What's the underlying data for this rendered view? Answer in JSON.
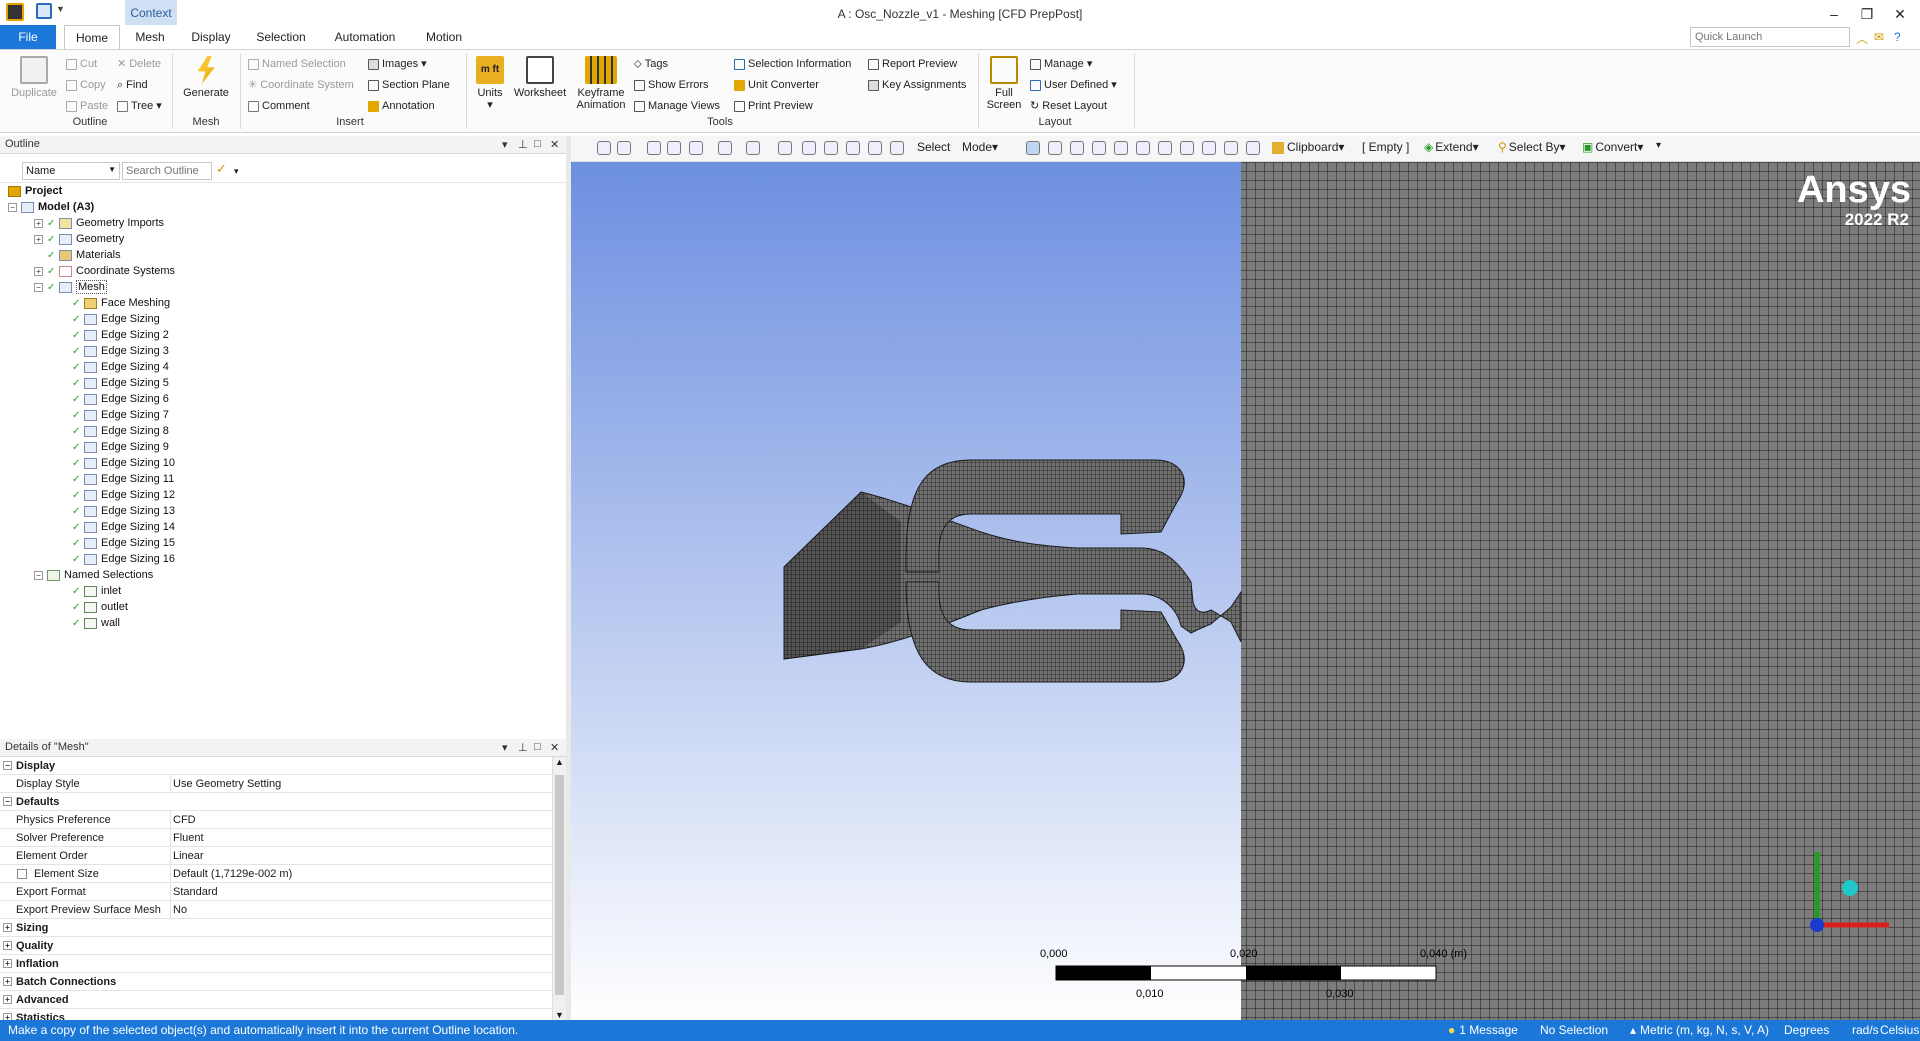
{
  "window": {
    "title": "A : Osc_Nozzle_v1 - Meshing [CFD PrepPost]",
    "context_tab": "Context"
  },
  "tabs": [
    "File",
    "Home",
    "Mesh",
    "Display",
    "Selection",
    "Automation",
    "Motion"
  ],
  "quick_launch": {
    "placeholder": "Quick Launch"
  },
  "ribbon": {
    "outline": {
      "duplicate": "Duplicate",
      "cut": "Cut",
      "copy": "Copy",
      "paste": "Paste",
      "delete": "Delete",
      "find": "Find",
      "tree": "Tree",
      "label": "Outline"
    },
    "mesh": {
      "generate": "Generate",
      "label": "Mesh"
    },
    "insert": {
      "named_selection": "Named Selection",
      "coordinate_system": "Coordinate System",
      "comment": "Comment",
      "images": "Images",
      "section_plane": "Section Plane",
      "annotation": "Annotation",
      "label": "Insert"
    },
    "tools": {
      "units": "Units",
      "worksheet": "Worksheet",
      "keyframe": "Keyframe",
      "animation": "Animation",
      "tags": "Tags",
      "show_errors": "Show Errors",
      "manage_views": "Manage Views",
      "selection_information": "Selection Information",
      "unit_converter": "Unit Converter",
      "print_preview": "Print Preview",
      "report_preview": "Report Preview",
      "key_assignments": "Key Assignments",
      "label": "Tools"
    },
    "layout": {
      "full": "Full",
      "screen": "Screen",
      "manage": "Manage",
      "user_defined": "User Defined",
      "reset_layout": "Reset Layout",
      "label": "Layout"
    }
  },
  "outline_panel": {
    "title": "Outline",
    "filter_label": "Name",
    "search_placeholder": "Search Outline",
    "tree": {
      "project": "Project",
      "model": "Model (A3)",
      "geometry_imports": "Geometry Imports",
      "geometry": "Geometry",
      "materials": "Materials",
      "coordinate_systems": "Coordinate Systems",
      "mesh": "Mesh",
      "mesh_children": [
        "Face Meshing",
        "Edge Sizing",
        "Edge Sizing 2",
        "Edge Sizing 3",
        "Edge Sizing 4",
        "Edge Sizing 5",
        "Edge Sizing 6",
        "Edge Sizing 7",
        "Edge Sizing 8",
        "Edge Sizing 9",
        "Edge Sizing 10",
        "Edge Sizing 11",
        "Edge Sizing 12",
        "Edge Sizing 13",
        "Edge Sizing 14",
        "Edge Sizing 15",
        "Edge Sizing 16"
      ],
      "named_selections": "Named Selections",
      "named_children": [
        "inlet",
        "outlet",
        "wall"
      ]
    }
  },
  "details_panel": {
    "title": "Details of \"Mesh\"",
    "rows": [
      {
        "type": "cat",
        "key": "Display"
      },
      {
        "type": "prop",
        "key": "Display Style",
        "value": "Use Geometry Setting"
      },
      {
        "type": "cat",
        "key": "Defaults"
      },
      {
        "type": "prop",
        "key": "Physics Preference",
        "value": "CFD"
      },
      {
        "type": "prop",
        "key": "Solver Preference",
        "value": "Fluent"
      },
      {
        "type": "prop",
        "key": "Element Order",
        "value": "Linear"
      },
      {
        "type": "propchk",
        "key": "Element Size",
        "value": "Default (1,7129e-002 m)"
      },
      {
        "type": "prop",
        "key": "Export Format",
        "value": "Standard"
      },
      {
        "type": "prop",
        "key": "Export Preview Surface Mesh",
        "value": "No"
      },
      {
        "type": "catc",
        "key": "Sizing"
      },
      {
        "type": "catc",
        "key": "Quality"
      },
      {
        "type": "catc",
        "key": "Inflation"
      },
      {
        "type": "catc",
        "key": "Batch Connections"
      },
      {
        "type": "catc",
        "key": "Advanced"
      },
      {
        "type": "catc",
        "key": "Statistics"
      }
    ]
  },
  "viewport_toolbar": {
    "select": "Select",
    "mode": "Mode",
    "clipboard": "Clipboard",
    "empty": "[ Empty ]",
    "extend": "Extend",
    "select_by": "Select By",
    "convert": "Convert"
  },
  "viewport": {
    "brand": "Ansys",
    "version": "2022 R2",
    "scale_labels": {
      "t0": "0,000",
      "t1": "0,020",
      "t2": "0,040 (m)",
      "b1": "0,010",
      "b2": "0,030"
    },
    "colors": {
      "bg_top": "#6c8fe0",
      "bg_bottom": "#ffffff",
      "mesh_fill": "#7a7a7a",
      "mesh_line": "#1e1e1e"
    }
  },
  "status_bar": {
    "hint": "Make a copy of the selected object(s) and automatically insert it into the current Outline location.",
    "messages": "1 Message",
    "selection": "No Selection",
    "units": "Metric (m, kg, N, s, V, A)",
    "angle": "Degrees",
    "angular_velocity": "rad/s",
    "temperature": "Celsius"
  }
}
